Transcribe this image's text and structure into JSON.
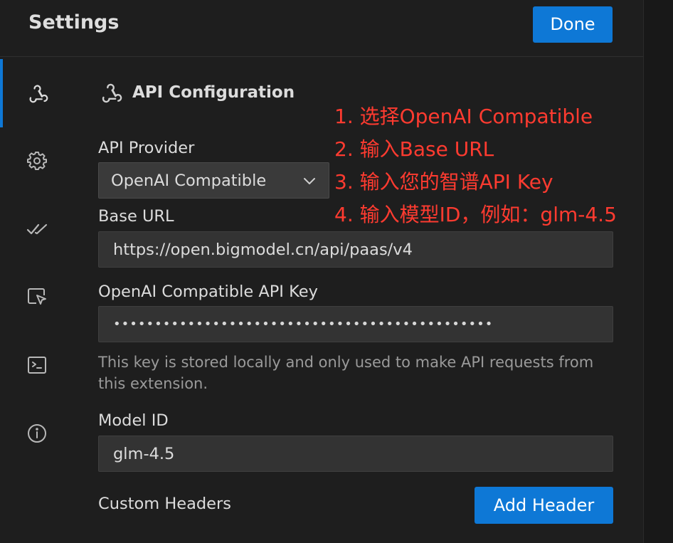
{
  "header": {
    "title": "Settings",
    "done_label": "Done"
  },
  "sidebar": {
    "items": [
      {
        "icon": "webhook-icon",
        "active": true
      },
      {
        "icon": "gear-icon",
        "active": false
      },
      {
        "icon": "check-all-icon",
        "active": false
      },
      {
        "icon": "cursor-select-icon",
        "active": false
      },
      {
        "icon": "terminal-icon",
        "active": false
      },
      {
        "icon": "info-icon",
        "active": false
      }
    ]
  },
  "section": {
    "title": "API Configuration",
    "icon": "webhook-icon"
  },
  "form": {
    "provider_label": "API Provider",
    "provider_value": "OpenAI Compatible",
    "base_url_label": "Base URL",
    "base_url_value": "https://open.bigmodel.cn/api/paas/v4",
    "api_key_label": "OpenAI Compatible API Key",
    "api_key_masked": "••••••••••••••••••••••••••••••••••••••••••••••",
    "api_key_help": "This key is stored locally and only used to make API requests from this extension.",
    "model_id_label": "Model ID",
    "model_id_value": "glm-4.5",
    "custom_headers_label": "Custom Headers",
    "add_header_label": "Add Header"
  },
  "annotations": [
    "1. 选择OpenAI Compatible",
    "2. 输入Base URL",
    "3. 输入您的智谱API Key",
    "4. 输入模型ID，例如：glm-4.5"
  ],
  "colors": {
    "accent": "#0e78d6",
    "annotation": "#ff3b30",
    "background": "#1e1e1e"
  }
}
